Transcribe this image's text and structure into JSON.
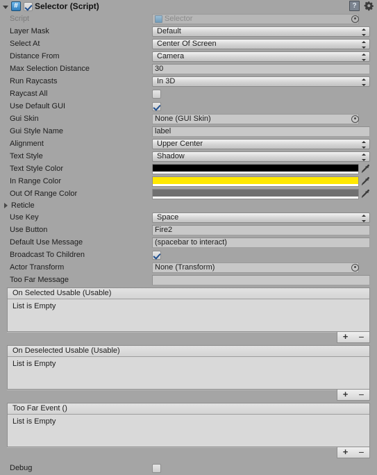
{
  "header": {
    "title": "Selector (Script)",
    "enabled_checkbox": true,
    "script_icon": "csharp-script-icon",
    "help_icon": "help-book-icon",
    "settings_icon": "gear-icon",
    "foldout_open": true
  },
  "fields": {
    "script": {
      "label": "Script",
      "value": "Selector",
      "disabled": true
    },
    "layer_mask": {
      "label": "Layer Mask",
      "value": "Default"
    },
    "select_at": {
      "label": "Select At",
      "value": "Center Of Screen"
    },
    "distance_from": {
      "label": "Distance From",
      "value": "Camera"
    },
    "max_selection_distance": {
      "label": "Max Selection Distance",
      "value": "30"
    },
    "run_raycasts": {
      "label": "Run Raycasts",
      "value": "In 3D"
    },
    "raycast_all": {
      "label": "Raycast All",
      "value": false
    },
    "use_default_gui": {
      "label": "Use Default GUI",
      "value": true
    },
    "gui_skin": {
      "label": "Gui Skin",
      "value": "None (GUI Skin)"
    },
    "gui_style_name": {
      "label": "Gui Style Name",
      "value": "label"
    },
    "alignment": {
      "label": "Alignment",
      "value": "Upper Center"
    },
    "text_style": {
      "label": "Text Style",
      "value": "Shadow"
    },
    "text_style_color": {
      "label": "Text Style Color",
      "color": "#000000"
    },
    "in_range_color": {
      "label": "In Range Color",
      "color": "#FFE800"
    },
    "out_of_range_color": {
      "label": "Out Of Range Color",
      "color": "#707070"
    },
    "reticle": {
      "label": "Reticle",
      "expanded": false
    },
    "use_key": {
      "label": "Use Key",
      "value": "Space"
    },
    "use_button": {
      "label": "Use Button",
      "value": "Fire2"
    },
    "default_use_message": {
      "label": "Default Use Message",
      "value": "(spacebar to interact)"
    },
    "broadcast_to_children": {
      "label": "Broadcast To Children",
      "value": true
    },
    "actor_transform": {
      "label": "Actor Transform",
      "value": "None (Transform)"
    },
    "too_far_message": {
      "label": "Too Far Message",
      "value": ""
    },
    "debug": {
      "label": "Debug",
      "value": false
    }
  },
  "events": [
    {
      "title": "On Selected Usable (Usable)",
      "empty_text": "List is Empty",
      "add_label": "+",
      "remove_label": "−"
    },
    {
      "title": "On Deselected Usable (Usable)",
      "empty_text": "List is Empty",
      "add_label": "+",
      "remove_label": "−"
    },
    {
      "title": "Too Far Event ()",
      "empty_text": "List is Empty",
      "add_label": "+",
      "remove_label": "−"
    }
  ]
}
